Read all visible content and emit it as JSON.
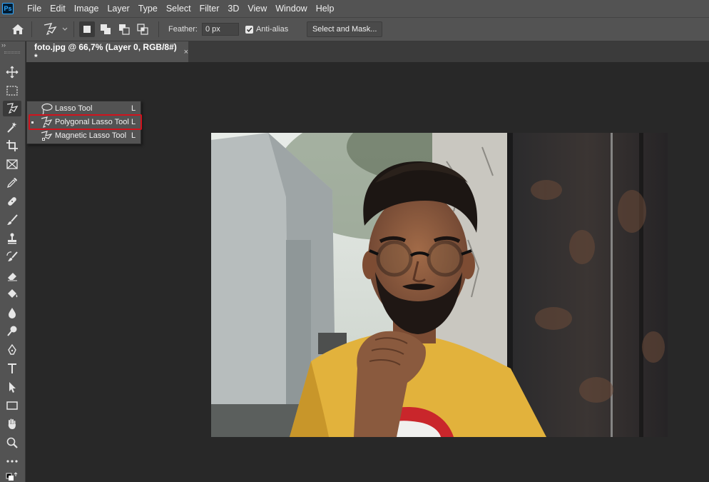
{
  "menubar": {
    "logo": "Ps",
    "items": [
      "File",
      "Edit",
      "Image",
      "Layer",
      "Type",
      "Select",
      "Filter",
      "3D",
      "View",
      "Window",
      "Help"
    ]
  },
  "options": {
    "feather_label": "Feather:",
    "feather_value": "0 px",
    "antialias_label": "Anti-alias",
    "antialias_checked": true,
    "select_mask_label": "Select and Mask..."
  },
  "toolbar": {
    "collapse": "››",
    "tools": [
      "move",
      "rectangular-marquee",
      "polygonal-lasso",
      "magic-wand",
      "crop",
      "frame",
      "eyedropper",
      "spot-healing",
      "brush",
      "clone-stamp",
      "history-brush",
      "eraser",
      "paint-bucket",
      "blur",
      "dodge",
      "pen",
      "type",
      "path-selection",
      "rectangle",
      "hand",
      "zoom",
      "more"
    ]
  },
  "document": {
    "tab_title": "foto.jpg @ 66,7% (Layer 0, RGB/8#) *",
    "close_glyph": "×"
  },
  "flyout": {
    "items": [
      {
        "label": "Lasso Tool",
        "key": "L",
        "active": false
      },
      {
        "label": "Polygonal Lasso Tool",
        "key": "L",
        "active": true
      },
      {
        "label": "Magnetic Lasso Tool",
        "key": "L",
        "active": false
      }
    ]
  },
  "colors": {
    "ui_panel": "#535353",
    "canvas_bg": "#282828",
    "highlight": "#d0131d",
    "ps_blue": "#31a8ff"
  }
}
